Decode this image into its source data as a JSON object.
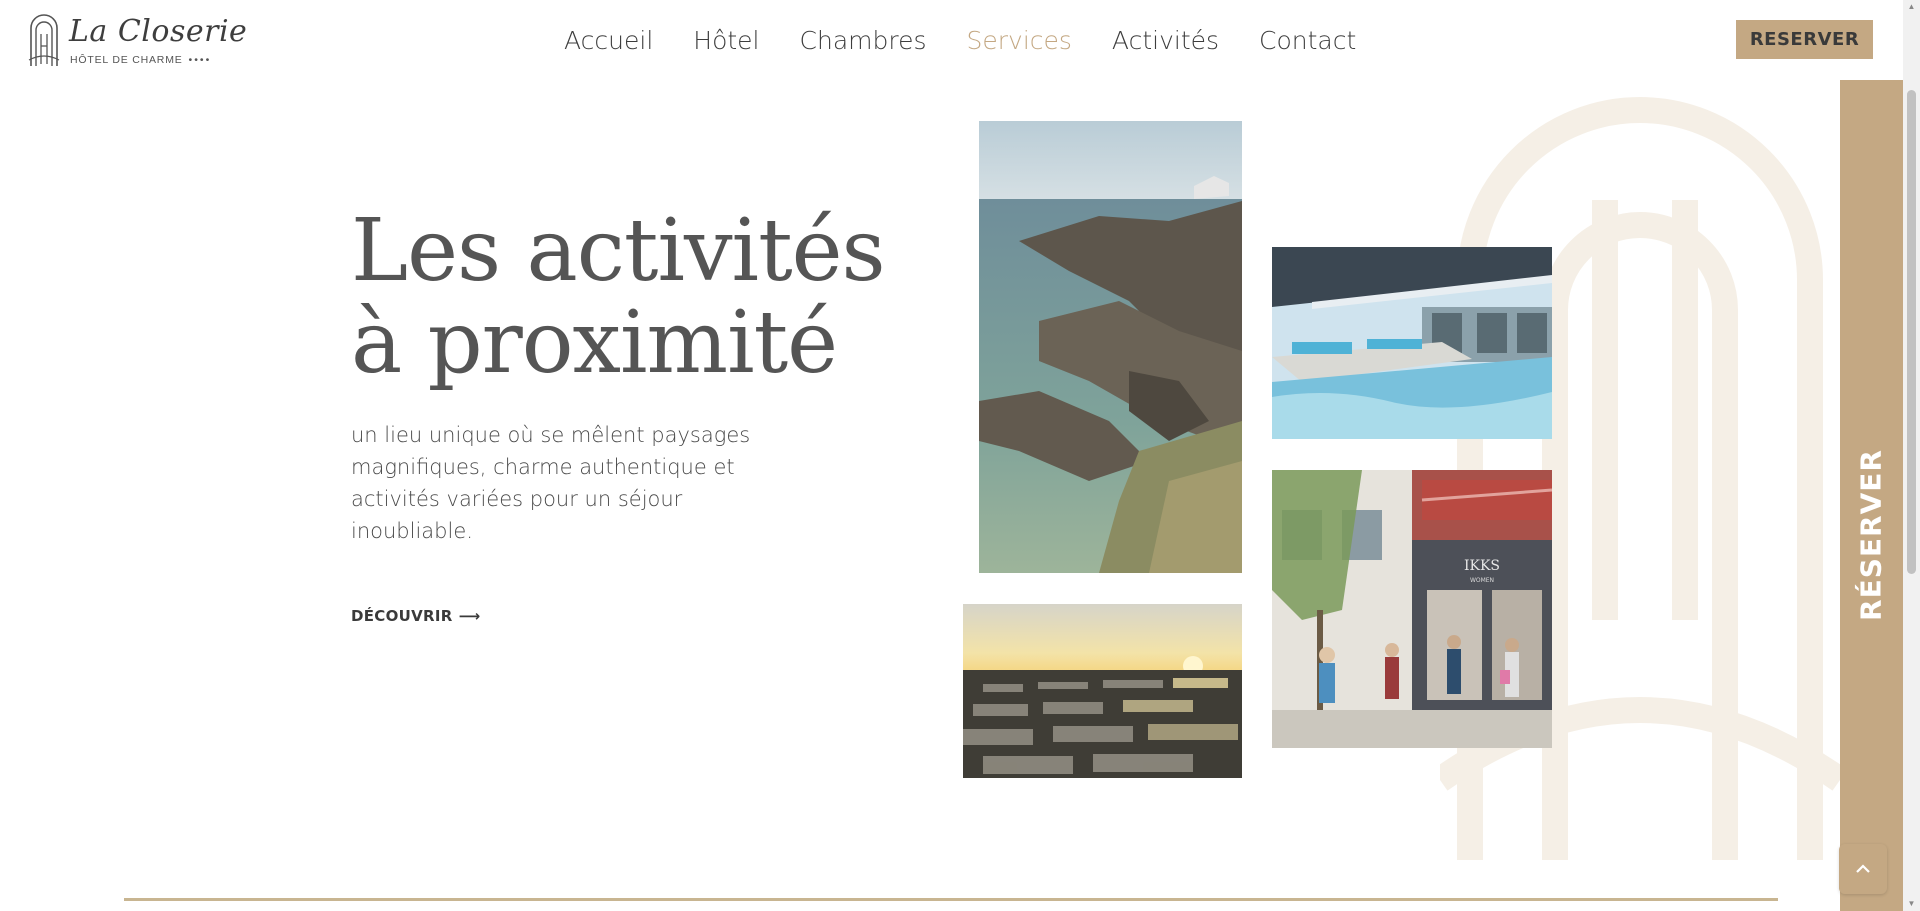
{
  "header": {
    "logo_script": "La Closerie",
    "logo_sub": "HÔTEL DE CHARME",
    "logo_stars": "••••",
    "nav": [
      "Accueil",
      "Hôtel",
      "Chambres",
      "Services",
      "Activités",
      "Contact"
    ],
    "active_nav": "Services",
    "reserve_label": "RESERVER"
  },
  "hero": {
    "title_line1": "Les activités",
    "title_line2": "à proximité",
    "description": "un lieu unique où se mêlent paysages magnifiques, charme authentique et activités variées pour un séjour inoubliable.",
    "cta_label": "DÉCOUVRIR",
    "cta_arrow": "⟶"
  },
  "side_tab": {
    "label": "RÉSERVER"
  },
  "shop_sign": {
    "name": "IKKS",
    "sub": "WOMEN"
  },
  "colors": {
    "accent": "#c4a883",
    "text": "#4a4a4a",
    "line": "#c8b591"
  },
  "icons": {
    "logo": "arch-logo-icon",
    "scroll_top": "chevron-up-icon",
    "cta": "arrow-right-icon"
  }
}
